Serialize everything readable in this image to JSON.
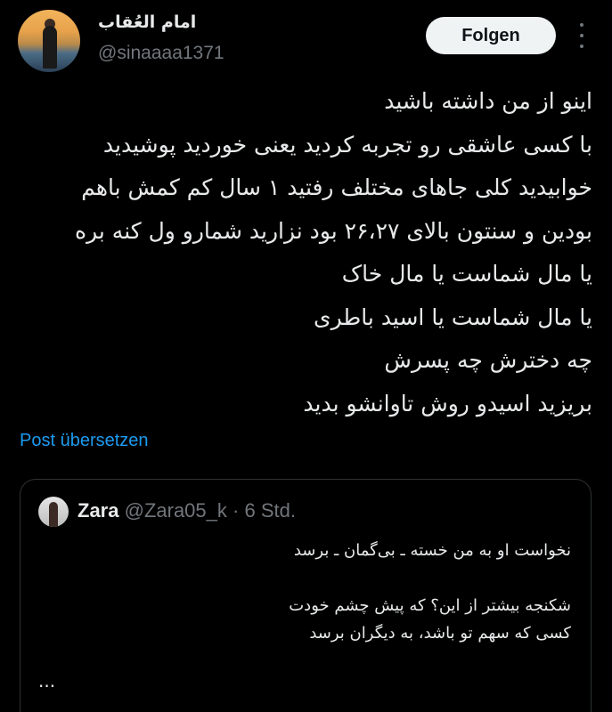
{
  "author": {
    "display_name": "امام العُقاب",
    "handle": "@sinaaaa1371"
  },
  "actions": {
    "follow_label": "Folgen",
    "more_icon": "more-vertical-icon"
  },
  "tweet": {
    "lines": [
      "اینو از من داشته باشید",
      "با کسی عاشقی رو تجربه کردید یعنی خوردید پوشیدید",
      "خوابیدید کلی جاهای مختلف رفتید ۱ سال کم کمش باهم",
      "بودین و سنتون بالای ۲۶،۲۷ بود نزارید شمارو ول کنه بره",
      "یا مال شماست یا مال خاک",
      "یا مال شماست یا اسید باطری",
      "چه دخترش چه پسرش",
      "بریزید اسیدو روش تاوانشو بدید"
    ],
    "translate_label": "Post übersetzen"
  },
  "quote": {
    "name": "Zara",
    "handle": "@Zara05_k",
    "separator": "·",
    "time": "6 Std.",
    "lines": [
      "نخواست او به من خسته ـ بی‌گمان ـ برسد",
      "",
      "شکنجه بیشتر از این؟ که پیش چشم خودت",
      "کسی که سهم تو باشد، به دیگران برسد"
    ],
    "ellipsis": "..."
  },
  "colors": {
    "background": "#000000",
    "text": "#e7e9ea",
    "muted": "#71767b",
    "link": "#1d9bf0",
    "border": "#2f3336"
  }
}
